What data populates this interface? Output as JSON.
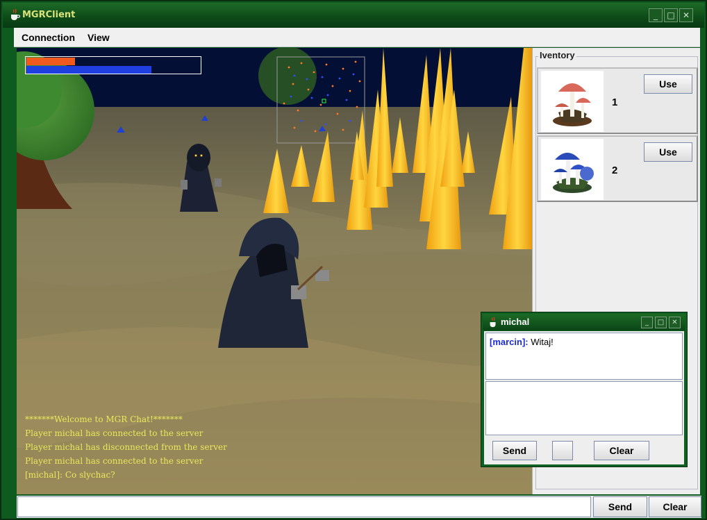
{
  "window": {
    "title": "MGRClient"
  },
  "menu": {
    "items": [
      "Connection",
      "View"
    ]
  },
  "status_bars": {
    "health_fraction": 0.28,
    "mana_fraction": 0.72,
    "health_color": "#f05a1e",
    "mana_color": "#1f3fe0"
  },
  "chat": {
    "lines": [
      "*******Welcome to MGR Chat!*******",
      "Player michal has connected to the server",
      "Player michal has disconnected from the server",
      "Player michal has connected to the server",
      "[michal]: Co slychac?"
    ],
    "input_value": "",
    "send_label": "Send",
    "clear_label": "Clear"
  },
  "inventory": {
    "title": "Iventory",
    "items": [
      {
        "icon": "red-mushroom-icon",
        "count": "1",
        "use_label": "Use"
      },
      {
        "icon": "blue-mushroom-icon",
        "count": "2",
        "use_label": "Use"
      }
    ]
  },
  "private_chat": {
    "title": "michal",
    "messages": [
      {
        "sender": "[marcin]:",
        "text": " Witaj!"
      }
    ],
    "send_label": "Send",
    "clear_label": "Clear"
  }
}
